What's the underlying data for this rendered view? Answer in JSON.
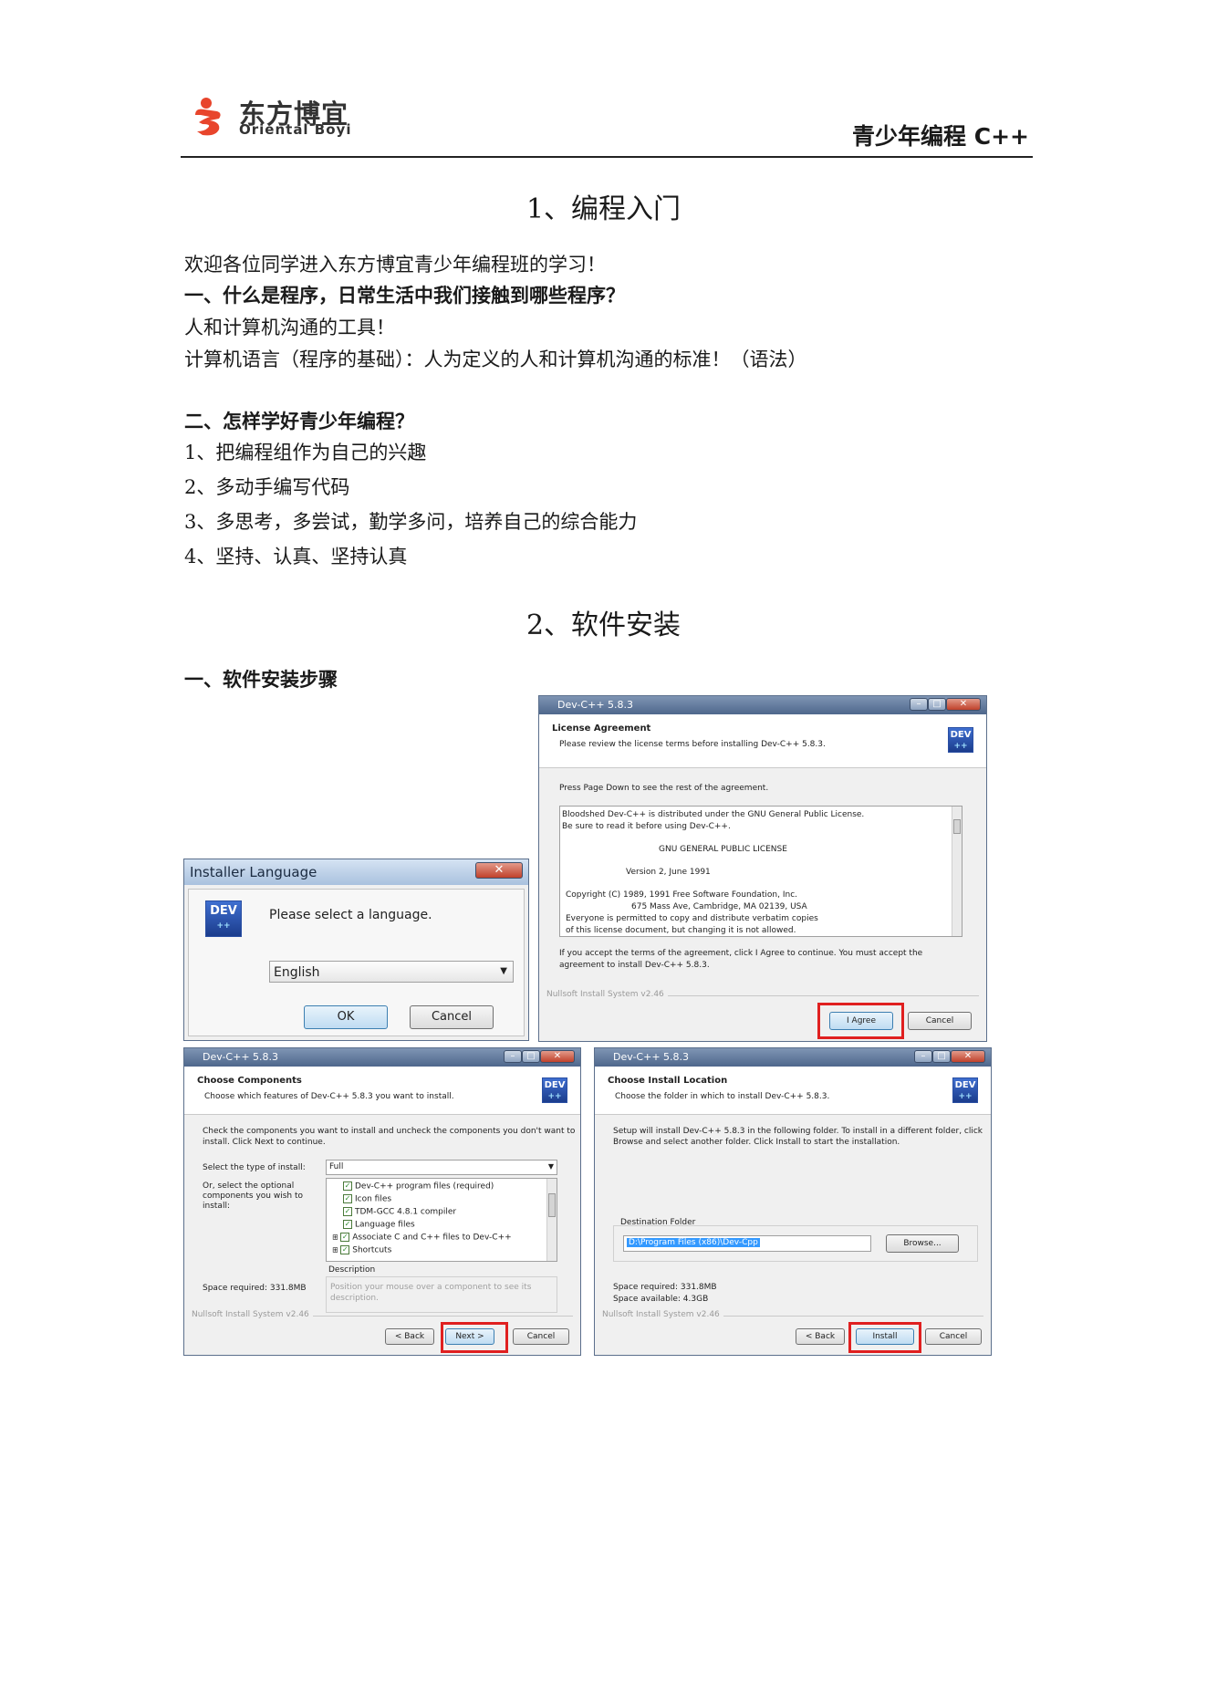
{
  "header": {
    "brand_cn": "东方博宜",
    "brand_en": "Oriental Boyi",
    "course": "青少年编程 C++"
  },
  "section1": {
    "title": "1、编程入门",
    "welcome": "欢迎各位同学进入东方博宜青少年编程班的学习！",
    "q1": "一、什么是程序，日常生活中我们接触到哪些程序？",
    "a1_1": "人和计算机沟通的工具！",
    "a1_2": "计算机语言（程序的基础）：人为定义的人和计算机沟通的标准！（语法）",
    "q2": "二、怎样学好青少年编程？",
    "tips": [
      "1、把编程组作为自己的兴趣",
      "2、多动手编写代码",
      "3、多思考，多尝试，勤学多问，培养自己的综合能力",
      "4、坚持、认真、坚持认真"
    ]
  },
  "section2": {
    "title": "2、软件安装",
    "steps_heading": "一、软件安装步骤"
  },
  "installer_language": {
    "title": "Installer Language",
    "prompt": "Please select a language.",
    "selected": "English",
    "ok": "OK",
    "cancel": "Cancel"
  },
  "license": {
    "title": "Dev-C++ 5.8.3",
    "header": "License Agreement",
    "subheader": "Please review the license terms before installing Dev-C++ 5.8.3.",
    "instruction": "Press Page Down to see the rest of the agreement.",
    "text_lines": [
      "Bloodshed Dev-C++ is distributed under the GNU General Public License.",
      "Be sure to read it before using Dev-C++.",
      "GNU GENERAL PUBLIC LICENSE",
      "Version 2, June 1991",
      "Copyright (C) 1989, 1991 Free Software Foundation, Inc.",
      "675 Mass Ave, Cambridge, MA 02139, USA",
      "Everyone is permitted to copy and distribute verbatim copies",
      "of this license document, but changing it is not allowed."
    ],
    "accept_note_1": "If you accept the terms of the agreement, click I Agree to continue. You must accept the",
    "accept_note_2": "agreement to install Dev-C++ 5.8.3.",
    "footer": "Nullsoft Install System v2.46",
    "agree": "I Agree",
    "cancel": "Cancel"
  },
  "components": {
    "title": "Dev-C++ 5.8.3",
    "header": "Choose Components",
    "subheader": "Choose which features of Dev-C++ 5.8.3 you want to install.",
    "instruction_1": "Check the components you want to install and uncheck the components you don't want to",
    "instruction_2": "install. Click Next to continue.",
    "type_label": "Select the type of install:",
    "type_value": "Full",
    "optional_label_1": "Or, select the optional",
    "optional_label_2": "components you wish to",
    "optional_label_3": "install:",
    "items": [
      "Dev-C++ program files (required)",
      "Icon files",
      "TDM-GCC 4.8.1 compiler",
      "Language files",
      "Associate C and C++ files to Dev-C++",
      "Shortcuts"
    ],
    "description_label": "Description",
    "description_1": "Position your mouse over a component to see its",
    "description_2": "description.",
    "space": "Space required: 331.8MB",
    "footer": "Nullsoft Install System v2.46",
    "back": "< Back",
    "next": "Next >",
    "cancel": "Cancel"
  },
  "location": {
    "title": "Dev-C++ 5.8.3",
    "header": "Choose Install Location",
    "subheader": "Choose the folder in which to install Dev-C++ 5.8.3.",
    "instruction_1": "Setup will install Dev-C++ 5.8.3 in the following folder. To install in a different folder, click",
    "instruction_2": "Browse and select another folder. Click Install to start the installation.",
    "dest_label": "Destination Folder",
    "dest_value": "D:\\Program Files (x86)\\Dev-Cpp",
    "browse": "Browse...",
    "space_required": "Space required: 331.8MB",
    "space_available": "Space available: 4.3GB",
    "footer": "Nullsoft Install System v2.46",
    "back": "< Back",
    "install": "Install",
    "cancel": "Cancel"
  },
  "colors": {
    "brand_red": "#e8452c",
    "highlight_red": "#e02020"
  }
}
